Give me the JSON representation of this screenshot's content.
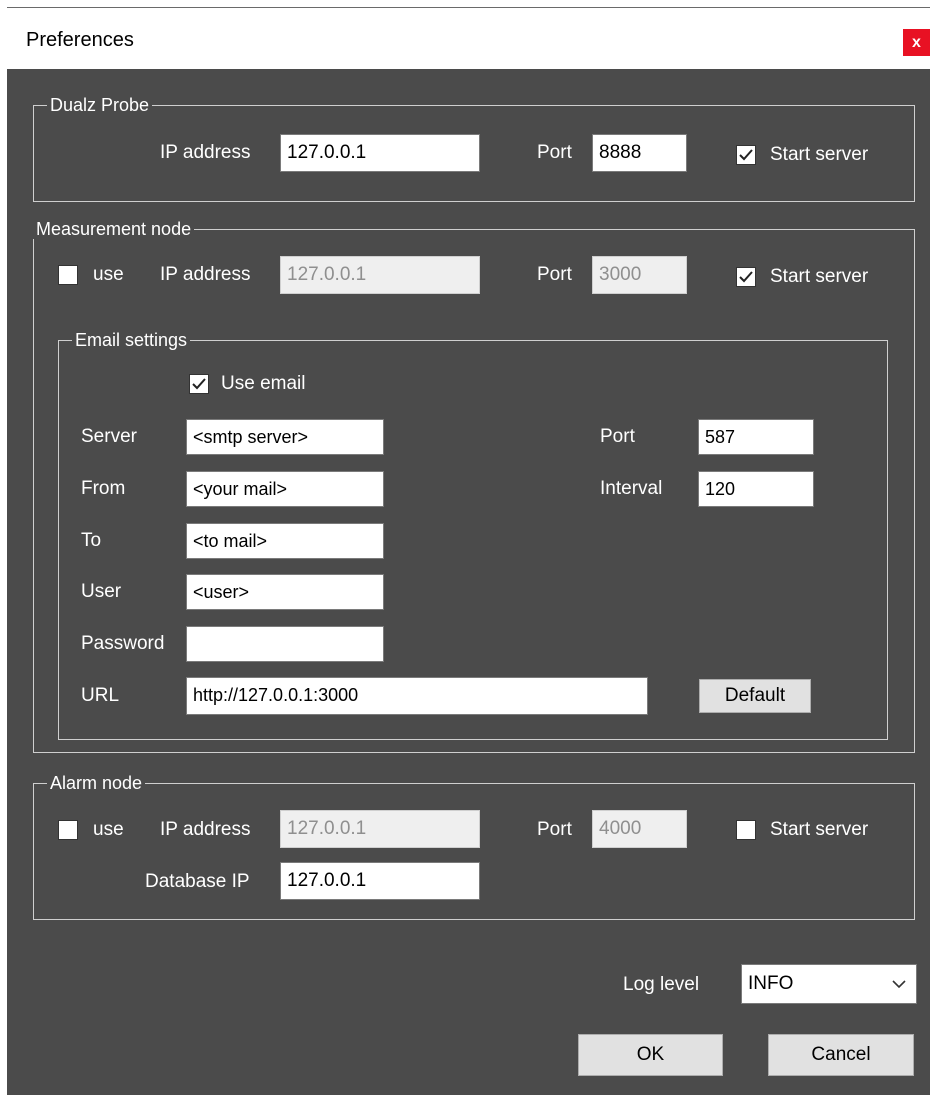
{
  "window": {
    "title": "Preferences",
    "close_glyph": "x"
  },
  "dualz_probe": {
    "legend": "Dualz Probe",
    "ip_label": "IP address",
    "ip_value": "127.0.0.1",
    "port_label": "Port",
    "port_value": "8888",
    "start_server_label": "Start server",
    "start_server_checked": true
  },
  "measurement_node": {
    "legend": "Measurement node",
    "use_label": "use",
    "use_checked": false,
    "ip_label": "IP address",
    "ip_value": "127.0.0.1",
    "port_label": "Port",
    "port_value": "3000",
    "start_server_label": "Start server",
    "start_server_checked": true
  },
  "email_settings": {
    "legend": "Email settings",
    "use_email_label": "Use email",
    "use_email_checked": true,
    "server_label": "Server",
    "server_value": "<smtp server>",
    "from_label": "From",
    "from_value": "<your mail>",
    "to_label": "To",
    "to_value": "<to mail>",
    "user_label": "User",
    "user_value": "<user>",
    "password_label": "Password",
    "password_value": "",
    "url_label": "URL",
    "url_value": "http://127.0.0.1:3000",
    "port_label": "Port",
    "port_value": "587",
    "interval_label": "Interval",
    "interval_value": "120",
    "default_button": "Default"
  },
  "alarm_node": {
    "legend": "Alarm node",
    "use_label": "use",
    "use_checked": false,
    "ip_label": "IP address",
    "ip_value": "127.0.0.1",
    "port_label": "Port",
    "port_value": "4000",
    "start_server_label": "Start server",
    "start_server_checked": false,
    "db_ip_label": "Database IP",
    "db_ip_value": "127.0.0.1"
  },
  "log": {
    "label": "Log level",
    "value": "INFO"
  },
  "buttons": {
    "ok": "OK",
    "cancel": "Cancel"
  },
  "icons": {
    "checkbox_check": "check-icon",
    "dropdown": "chevron-down-icon",
    "close": "close-icon"
  },
  "colors": {
    "client_bg": "#4b4b4b",
    "close_red": "#e81123",
    "group_border": "#cfcfcf"
  }
}
